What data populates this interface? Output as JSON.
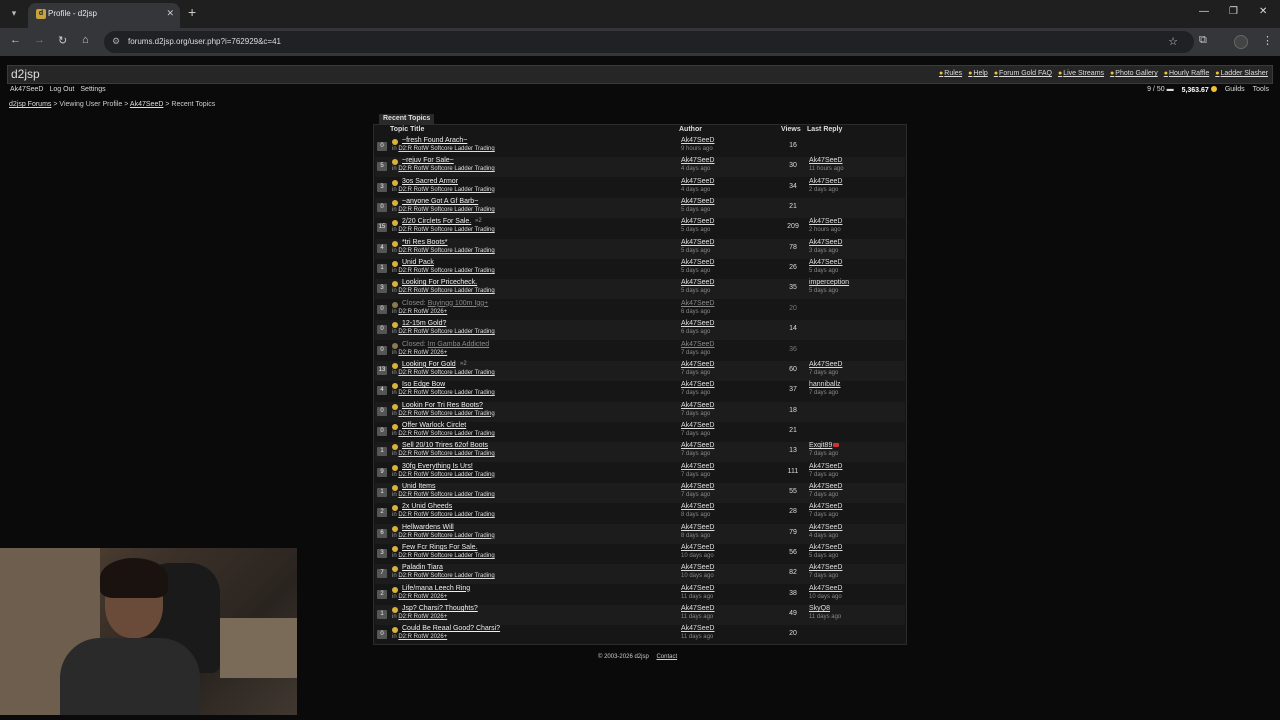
{
  "browser": {
    "tab_title": "Profile - d2jsp",
    "url": "forums.d2jsp.org/user.php?i=762929&c=41"
  },
  "site": {
    "logo": "d2jsp",
    "header_links": [
      "Rules",
      "Help",
      "Forum Gold FAQ",
      "Live Streams",
      "Photo Gallery",
      "Hourly Raffle",
      "Ladder Slasher"
    ],
    "user_links": [
      "Ak47SeeD",
      "Log Out",
      "Settings"
    ],
    "messages": "9 / 50",
    "gold": "5,363.67",
    "right_links": [
      "Guilds",
      "Tools"
    ]
  },
  "breadcrumb": {
    "forums": "d2jsp Forums",
    "sep1": ">",
    "viewing": "Viewing User Profile",
    "sep2": ">",
    "user": "Ak47SeeD",
    "sep3": ">",
    "current": "Recent Topics"
  },
  "topics": {
    "panel_title": "Recent Topics",
    "headers": {
      "title": "Topic Title",
      "author": "Author",
      "views": "Views",
      "last_reply": "Last Reply"
    },
    "in_label": "in",
    "rows": [
      {
        "count": "0",
        "title": "~fresh Found Arach~",
        "forum": "D2:R RotW Softcore Ladder Trading",
        "author": "Ak47SeeD",
        "atime": "9 hours ago",
        "views": "16",
        "lr_user": "",
        "lr_time": ""
      },
      {
        "count": "5",
        "title": "~rejuv For Sale~",
        "forum": "D2:R RotW Softcore Ladder Trading",
        "author": "Ak47SeeD",
        "atime": "4 days ago",
        "views": "30",
        "lr_user": "Ak47SeeD",
        "lr_time": "11 hours ago"
      },
      {
        "count": "3",
        "title": "3os Sacred Armor",
        "forum": "D2:R RotW Softcore Ladder Trading",
        "author": "Ak47SeeD",
        "atime": "4 days ago",
        "views": "34",
        "lr_user": "Ak47SeeD",
        "lr_time": "2 days ago"
      },
      {
        "count": "0",
        "title": "~anyone Got A Gf Barb~",
        "forum": "D2:R RotW Softcore Ladder Trading",
        "author": "Ak47SeeD",
        "atime": "5 days ago",
        "views": "21",
        "lr_user": "",
        "lr_time": ""
      },
      {
        "count": "15",
        "title": "2/20 Circlets For Sale.",
        "pages": "2",
        "forum": "D2:R RotW Softcore Ladder Trading",
        "author": "Ak47SeeD",
        "atime": "5 days ago",
        "views": "209",
        "lr_user": "Ak47SeeD",
        "lr_time": "2 hours ago"
      },
      {
        "count": "4",
        "title": "*tri Res Boots*",
        "forum": "D2:R RotW Softcore Ladder Trading",
        "author": "Ak47SeeD",
        "atime": "5 days ago",
        "views": "78",
        "lr_user": "Ak47SeeD",
        "lr_time": "3 days ago"
      },
      {
        "count": "1",
        "title": "Unid Pack",
        "forum": "D2:R RotW Softcore Ladder Trading",
        "author": "Ak47SeeD",
        "atime": "5 days ago",
        "views": "26",
        "lr_user": "Ak47SeeD",
        "lr_time": "5 days ago"
      },
      {
        "count": "3",
        "title": "Looking For Pricecheck.",
        "forum": "D2:R RotW Softcore Ladder Trading",
        "author": "Ak47SeeD",
        "atime": "5 days ago",
        "views": "35",
        "lr_user": "imperception",
        "lr_time": "5 days ago"
      },
      {
        "count": "0",
        "closed": true,
        "closed_label": "Closed:",
        "title": "Buyingg 100m Igg+",
        "forum": "D2:R RotW 2026+",
        "author": "Ak47SeeD",
        "atime": "6 days ago",
        "views": "20",
        "lr_user": "",
        "lr_time": ""
      },
      {
        "count": "0",
        "title": "12-15m Gold?",
        "forum": "D2:R RotW Softcore Ladder Trading",
        "author": "Ak47SeeD",
        "atime": "6 days ago",
        "views": "14",
        "lr_user": "",
        "lr_time": ""
      },
      {
        "count": "0",
        "closed": true,
        "closed_label": "Closed:",
        "title": "Im Gamba Addicted",
        "forum": "D2:R RotW 2026+",
        "author": "Ak47SeeD",
        "atime": "7 days ago",
        "views": "36",
        "lr_user": "",
        "lr_time": ""
      },
      {
        "count": "13",
        "title": "Looking For Gold",
        "pages": "2",
        "forum": "D2:R RotW Softcore Ladder Trading",
        "author": "Ak47SeeD",
        "atime": "7 days ago",
        "views": "60",
        "lr_user": "Ak47SeeD",
        "lr_time": "7 days ago"
      },
      {
        "count": "4",
        "title": "Iso Edge Bow",
        "forum": "D2:R RotW Softcore Ladder Trading",
        "author": "Ak47SeeD",
        "atime": "7 days ago",
        "views": "37",
        "lr_user": "hanniballz",
        "lr_time": "7 days ago"
      },
      {
        "count": "0",
        "title": "Lookin For Tri Res Boots?",
        "forum": "D2:R RotW Softcore Ladder Trading",
        "author": "Ak47SeeD",
        "atime": "7 days ago",
        "views": "18",
        "lr_user": "",
        "lr_time": ""
      },
      {
        "count": "0",
        "title": "Offer Warlock Circlet",
        "forum": "D2:R RotW Softcore Ladder Trading",
        "author": "Ak47SeeD",
        "atime": "7 days ago",
        "views": "21",
        "lr_user": "",
        "lr_time": ""
      },
      {
        "count": "1",
        "title": "Sell 20/10 Trires 62of Boots",
        "forum": "D2:R RotW Softcore Ladder Trading",
        "author": "Ak47SeeD",
        "atime": "7 days ago",
        "views": "13",
        "lr_user": "Exqit89",
        "lr_badge": true,
        "lr_time": "7 days ago"
      },
      {
        "count": "9",
        "title": "30fg Everything Is Urs!",
        "forum": "D2:R RotW Softcore Ladder Trading",
        "author": "Ak47SeeD",
        "atime": "7 days ago",
        "views": "111",
        "lr_user": "Ak47SeeD",
        "lr_time": "7 days ago"
      },
      {
        "count": "1",
        "title": "Unid Items",
        "forum": "D2:R RotW Softcore Ladder Trading",
        "author": "Ak47SeeD",
        "atime": "7 days ago",
        "views": "55",
        "lr_user": "Ak47SeeD",
        "lr_time": "7 days ago"
      },
      {
        "count": "2",
        "title": "2x Unid Gheeds",
        "forum": "D2:R RotW Softcore Ladder Trading",
        "author": "Ak47SeeD",
        "atime": "8 days ago",
        "views": "28",
        "lr_user": "Ak47SeeD",
        "lr_time": "7 days ago"
      },
      {
        "count": "6",
        "title": "Hellwardens Will",
        "forum": "D2:R RotW Softcore Ladder Trading",
        "author": "Ak47SeeD",
        "atime": "8 days ago",
        "views": "79",
        "lr_user": "Ak47SeeD",
        "lr_time": "4 days ago"
      },
      {
        "count": "3",
        "title": "Few Fcr Rings For Sale.",
        "forum": "D2:R RotW Softcore Ladder Trading",
        "author": "Ak47SeeD",
        "atime": "10 days ago",
        "views": "56",
        "lr_user": "Ak47SeeD",
        "lr_time": "5 days ago"
      },
      {
        "count": "7",
        "title": "Paladin Tiara",
        "forum": "D2:R RotW Softcore Ladder Trading",
        "author": "Ak47SeeD",
        "atime": "10 days ago",
        "views": "82",
        "lr_user": "Ak47SeeD",
        "lr_time": "7 days ago"
      },
      {
        "count": "2",
        "title": "Life/mana Leech Ring",
        "forum": "D2:R RotW 2026+",
        "author": "Ak47SeeD",
        "atime": "11 days ago",
        "views": "38",
        "lr_user": "Ak47SeeD",
        "lr_time": "10 days ago"
      },
      {
        "count": "1",
        "title": "Jsp? Charsi? Thoughts?",
        "forum": "D2:R RotW 2026+",
        "author": "Ak47SeeD",
        "atime": "11 days ago",
        "views": "49",
        "lr_user": "SkyQ8",
        "lr_time": "11 days ago"
      },
      {
        "count": "0",
        "title": "Could Be Reaal Good? Charsi?",
        "forum": "D2:R RotW 2026+",
        "author": "Ak47SeeD",
        "atime": "11 days ago",
        "views": "20",
        "lr_user": "",
        "lr_time": ""
      }
    ]
  },
  "footer": {
    "copyright": "© 2003-2026 d2jsp",
    "contact": "Contact"
  }
}
